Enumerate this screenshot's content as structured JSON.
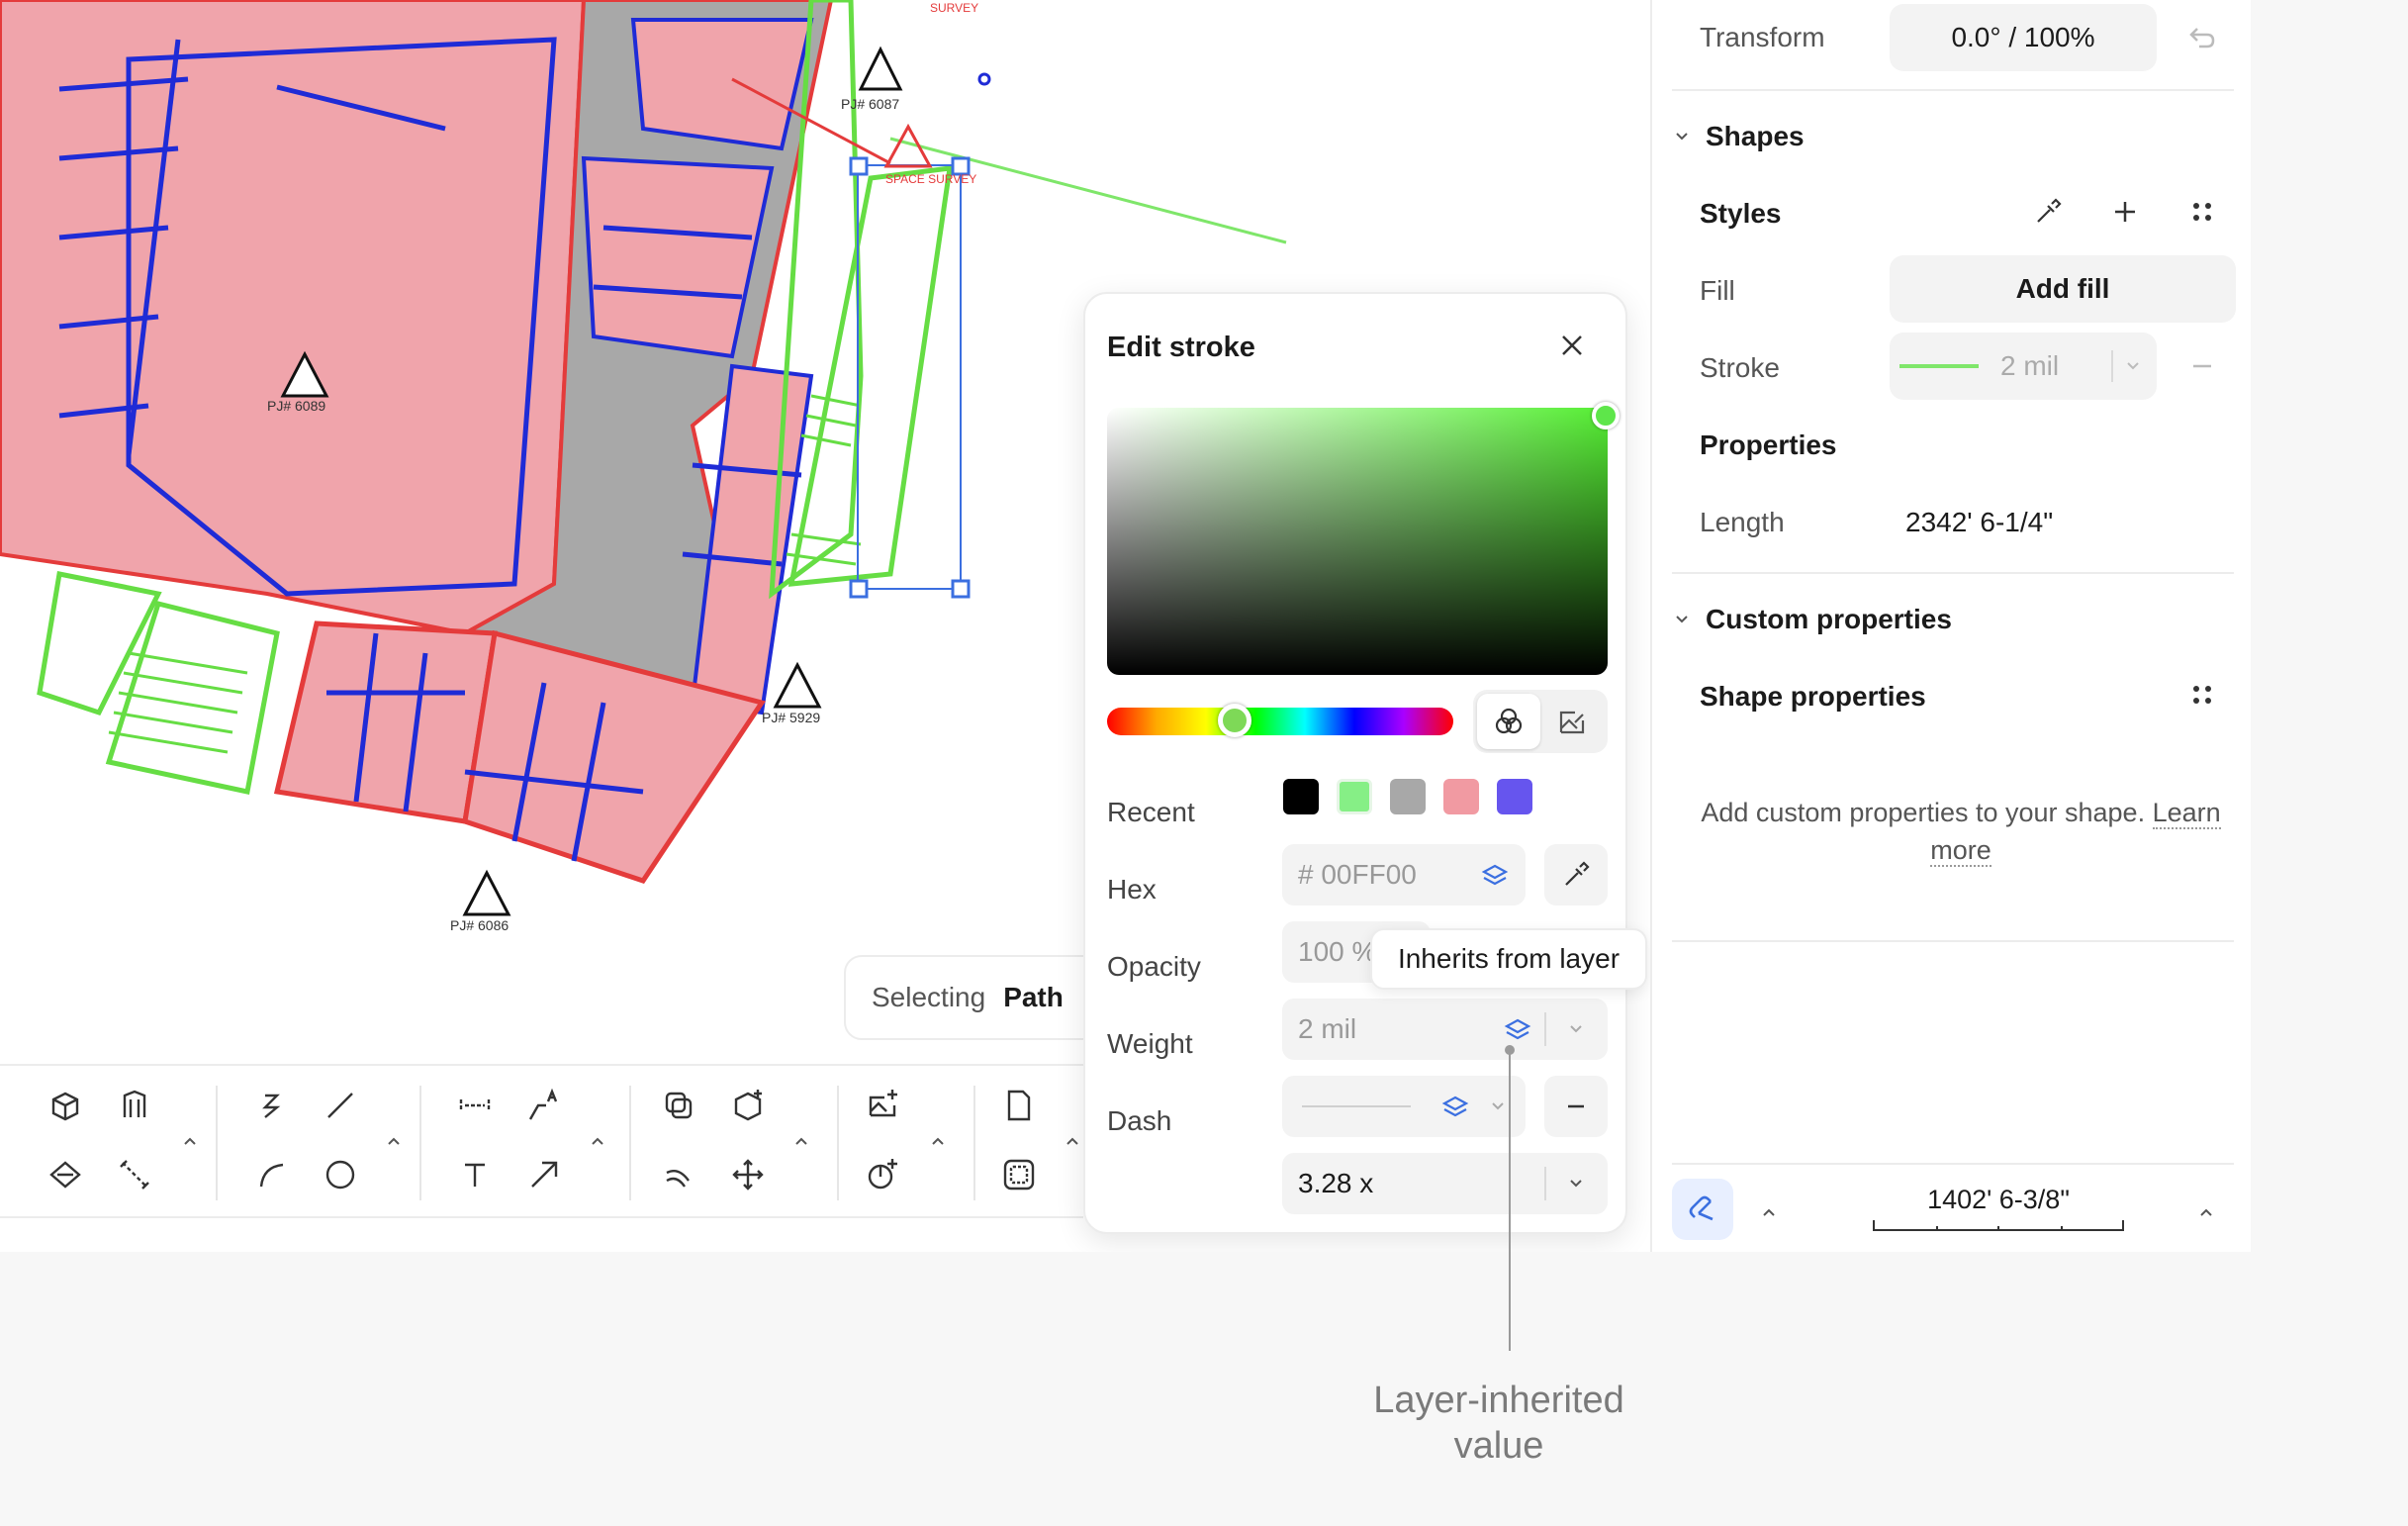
{
  "canvas": {
    "floorplan_labels": [
      "PJ# 6087",
      "PJ# 6089",
      "PJ# 5929",
      "PJ# 6086",
      "SPACE SURVEY",
      "SURVEY"
    ],
    "selecting": {
      "label": "Selecting",
      "value": "Path"
    }
  },
  "toolbar": {
    "icons": [
      "cube-icon",
      "extrude-icon",
      "polygon-icon",
      "measure-icon",
      "lightning-icon",
      "line-icon",
      "arc-icon",
      "circle-icon",
      "dimension-icon",
      "leader-icon",
      "text-icon",
      "arrow-icon",
      "copy-icon",
      "box-add-icon",
      "offset-icon",
      "move-icon",
      "ai-image-icon",
      "ai-symbol-icon",
      "page-icon",
      "frame-icon"
    ]
  },
  "edit_stroke": {
    "title": "Edit stroke",
    "recent_label": "Recent",
    "recent_colors": [
      "#000000",
      "#86ef86",
      "#a8a8a8",
      "#f19aa2",
      "#6655ee"
    ],
    "hex_label": "Hex",
    "hex_value": "# 00FF00",
    "opacity_label": "Opacity",
    "opacity_value": "100 %",
    "weight_label": "Weight",
    "weight_value": "2 mil",
    "dash_label": "Dash",
    "scale_value": "3.28 x",
    "tooltip": "Inherits from layer",
    "selected_color": "#00FF00"
  },
  "panel": {
    "transform_label": "Transform",
    "transform_value": "0.0° / 100%",
    "shapes_section": "Shapes",
    "styles_label": "Styles",
    "fill_label": "Fill",
    "fill_button": "Add fill",
    "stroke_label": "Stroke",
    "stroke_value": "2 mil",
    "properties_label": "Properties",
    "length_label": "Length",
    "length_value": "2342' 6-1/4\"",
    "custom_section": "Custom properties",
    "shape_properties_label": "Shape properties",
    "empty_note": "Add custom properties to your shape.",
    "learn_more": "Learn more",
    "scale_readout": "1402' 6-3/8\""
  },
  "annotation": {
    "line1": "Layer-inherited",
    "line2": "value"
  },
  "colors": {
    "accent": "#3b6fe0",
    "room_fill": "#f0a4ab",
    "corridor": "#a8a8a8",
    "wall": "#1f2bd6",
    "selected_stroke": "#7fe66a"
  }
}
